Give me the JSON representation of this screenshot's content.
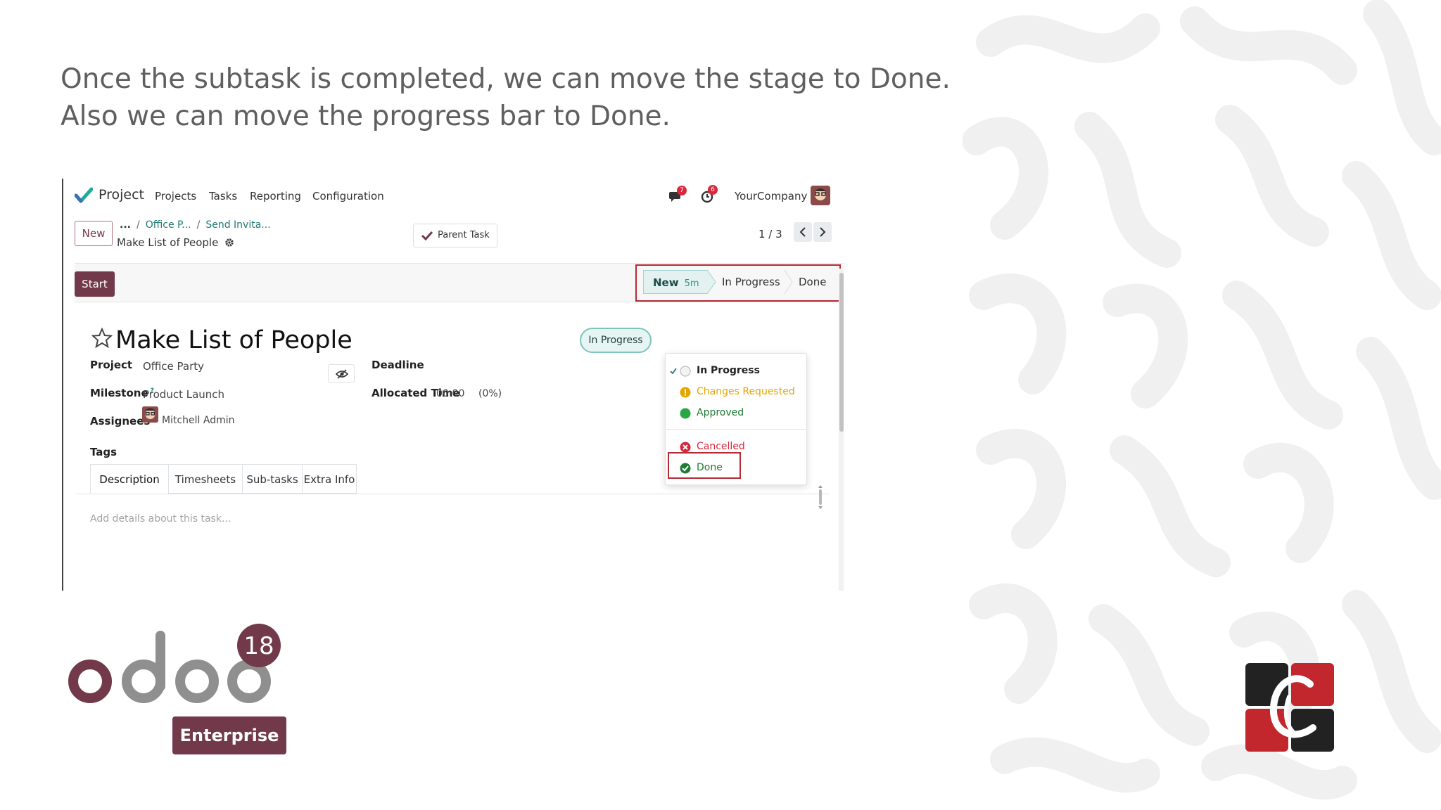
{
  "caption": {
    "line1": "Once the subtask is completed, we can move the stage to Done.",
    "line2": "Also we can move the progress bar to Done."
  },
  "navbar": {
    "app_name": "Project",
    "menu": [
      "Projects",
      "Tasks",
      "Reporting",
      "Configuration"
    ],
    "messages_badge": "7",
    "activities_badge": "6",
    "company": "YourCompany"
  },
  "control_panel": {
    "new_label": "New",
    "breadcrumbs": [
      "...",
      "Office P...",
      "Send Invita..."
    ],
    "record_name": "Make List of People",
    "parent_task_label": "Parent Task",
    "pager": "1 / 3"
  },
  "statusbar": {
    "start_label": "Start",
    "stages": [
      {
        "label": "New",
        "duration": "5m",
        "active": true
      },
      {
        "label": "In Progress",
        "active": false
      },
      {
        "label": "Done",
        "active": false
      }
    ]
  },
  "form": {
    "title": "Make List of People",
    "state_label": "In Progress",
    "fields": {
      "project_label": "Project",
      "project_value": "Office Party",
      "milestone_label": "Milestone",
      "milestone_help": "?",
      "milestone_value": "Product Launch",
      "assignees_label": "Assignees",
      "assignees_value": "Mitchell Admin",
      "tags_label": "Tags",
      "deadline_label": "Deadline",
      "allocated_label": "Allocated Time",
      "allocated_value": "00:00",
      "allocated_percent": "(0%)"
    },
    "tabs": [
      "Description",
      "Timesheets",
      "Sub-tasks",
      "Extra Info"
    ],
    "description_placeholder": "Add details about this task..."
  },
  "state_dropdown": {
    "items": [
      {
        "label": "In Progress",
        "color": "#222222",
        "selected": true
      },
      {
        "label": "Changes Requested",
        "color": "#e6a400"
      },
      {
        "label": "Approved",
        "color": "#1f7a34"
      },
      {
        "label": "Cancelled",
        "color": "#d9263b"
      },
      {
        "label": "Done",
        "color": "#1f7a34"
      }
    ]
  },
  "branding": {
    "version": "18",
    "edition": "Enterprise"
  },
  "colors": {
    "primary": "#71394a",
    "teal": "#1f7a75",
    "highlight": "#b42b34"
  }
}
